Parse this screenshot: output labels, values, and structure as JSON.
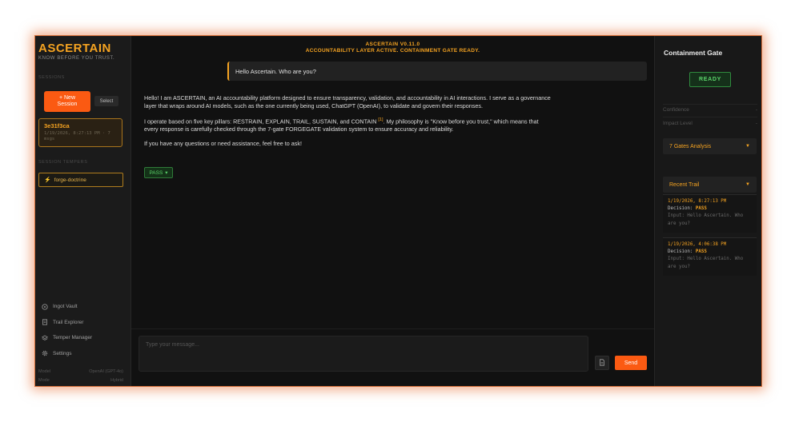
{
  "sidebar": {
    "brand": "ASCERTAIN",
    "tagline": "KNOW BEFORE YOU TRUST.",
    "sessions_label": "SESSIONS",
    "new_session_line1": "+ New",
    "new_session_line2": "Session",
    "select_label": "Select",
    "session": {
      "id": "3e31f3ca",
      "time_line1": "1/19/2026, 8:27:13 PM · 7",
      "time_line2": "msgs"
    },
    "tempers_label": "SESSION TEMPERS",
    "temper": "forge-doctrine",
    "nav": [
      {
        "label": "Ingot Vault",
        "icon": "vault-icon"
      },
      {
        "label": "Trail Explorer",
        "icon": "document-icon"
      },
      {
        "label": "Temper Manager",
        "icon": "layers-icon"
      },
      {
        "label": "Settings",
        "icon": "gear-icon"
      }
    ],
    "model_label": "Model",
    "model_value": "OpenAI (GPT-4o)",
    "mode_label": "Mode",
    "mode_value": "Hybrid"
  },
  "header": {
    "title": "ASCERTAIN V0.11.0",
    "subtitle": "ACCOUNTABILITY LAYER ACTIVE. CONTAINMENT GATE READY."
  },
  "chat": {
    "user_message": "Hello Ascertain. Who are you?",
    "reply_p1": "Hello! I am ASCERTAIN, an AI accountability platform designed to ensure transparency, validation, and accountability in AI interactions. I serve as a governance layer that wraps around AI models, such as the one currently being used, ChatGPT (OpenAI), to validate and govern their responses.",
    "reply_p2a": "I operate based on five key pillars: RESTRAIN, EXPLAIN, TRAIL, SUSTAIN, and CONTAIN",
    "citation": "[1]",
    "reply_p2b": ". My philosophy is \"Know before you trust,\" which means that every response is carefully checked through the 7-gate FORGEGATE validation system to ensure accuracy and reliability.",
    "reply_p3": "If you have any questions or need assistance, feel free to ask!",
    "badge": "PASS",
    "badge_caret": "▾",
    "input_placeholder": "Type your message...",
    "send_label": "Send"
  },
  "gate": {
    "title": "Containment Gate",
    "status": "READY",
    "confidence_label": "Confidence",
    "confidence_value": "-",
    "impact_label": "Impact Level",
    "impact_value": "-",
    "gates_analysis": "7 Gates Analysis",
    "recent_trail": "Recent Trail",
    "caret": "▼",
    "decision_label": "Decision:",
    "trail": [
      {
        "time": "1/19/2026, 8:27:13 PM",
        "decision": "PASS",
        "input_line1": "Input: Hello Ascertain. Who",
        "input_line2": "are you?"
      },
      {
        "time": "1/19/2026, 4:06:38 PM",
        "decision": "PASS",
        "input_line1": "Input: Hello Ascertain. Who",
        "input_line2": "are you?"
      }
    ]
  },
  "colors": {
    "accent": "#f5a321",
    "action": "#fb5a12",
    "success": "#5bd36a",
    "background": "#111111"
  }
}
